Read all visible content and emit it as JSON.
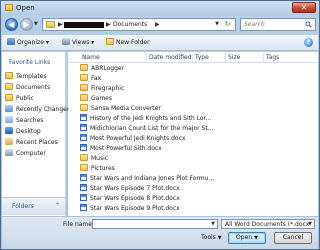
{
  "window": {
    "title": "Open",
    "close_glyph": "✕"
  },
  "address_bar": {
    "separator": "▶",
    "crumb": "Documents",
    "dropdown_glyph": "▼",
    "refresh_glyph": "↻"
  },
  "search": {
    "placeholder": "Search"
  },
  "toolbar": {
    "organize_label": "Organize",
    "views_label": "Views",
    "new_folder_label": "New Folder",
    "dropdown_glyph": "▾",
    "help_glyph": "?"
  },
  "favorites": {
    "header": "Favorite Links",
    "items": [
      {
        "label": "Templates",
        "icon": "folder-icon"
      },
      {
        "label": "Documents",
        "icon": "documents-icon"
      },
      {
        "label": "Public",
        "icon": "folder-icon"
      },
      {
        "label": "Recently Changed",
        "icon": "recent-icon"
      },
      {
        "label": "Searches",
        "icon": "search-folder-icon"
      },
      {
        "label": "Desktop",
        "icon": "desktop-icon"
      },
      {
        "label": "Recent Places",
        "icon": "recent-places-icon"
      },
      {
        "label": "Computer",
        "icon": "computer-icon"
      }
    ],
    "folders_label": "Folders",
    "folders_chevron": "⌃"
  },
  "columns": {
    "name": "Name",
    "date_modified": "Date modified",
    "type": "Type",
    "size": "Size",
    "tags": "Tags"
  },
  "files": [
    {
      "name": "ABRLogger",
      "kind": "folder"
    },
    {
      "name": "Fax",
      "kind": "folder"
    },
    {
      "name": "Firegraphic",
      "kind": "folder"
    },
    {
      "name": "Games",
      "kind": "folder"
    },
    {
      "name": "Sansa Media Converter",
      "kind": "folder"
    },
    {
      "name": "History of the Jedi Knights and Sith Lor...",
      "kind": "doc"
    },
    {
      "name": "Midichlorian Count List for the major St...",
      "kind": "doc"
    },
    {
      "name": "Most Powerful Jedi Knights.docx",
      "kind": "doc"
    },
    {
      "name": "Most Powerful Sith.docx",
      "kind": "doc"
    },
    {
      "name": "Music",
      "kind": "folder"
    },
    {
      "name": "Pictures",
      "kind": "folder"
    },
    {
      "name": "Star Wars and Indiana Jones Plot Formu...",
      "kind": "doc"
    },
    {
      "name": "Star Wars Episode 7 Plot.docx",
      "kind": "doc"
    },
    {
      "name": "Star Wars Episode 8 Plot.docx",
      "kind": "doc"
    },
    {
      "name": "Star Wars Episode 9 Plot.docx",
      "kind": "doc"
    }
  ],
  "bottom": {
    "file_name_label": "File name:",
    "file_name_value": "",
    "filter_value": "All Word Documents (*.docx",
    "tools_label": "Tools",
    "open_label": "Open",
    "cancel_label": "Cancel",
    "dropdown_glyph": "▼",
    "grip_glyph": "⋰"
  },
  "colors": {
    "accent": "#2d4f86",
    "folder": "#efc455",
    "word_doc": "#3b62b0"
  }
}
